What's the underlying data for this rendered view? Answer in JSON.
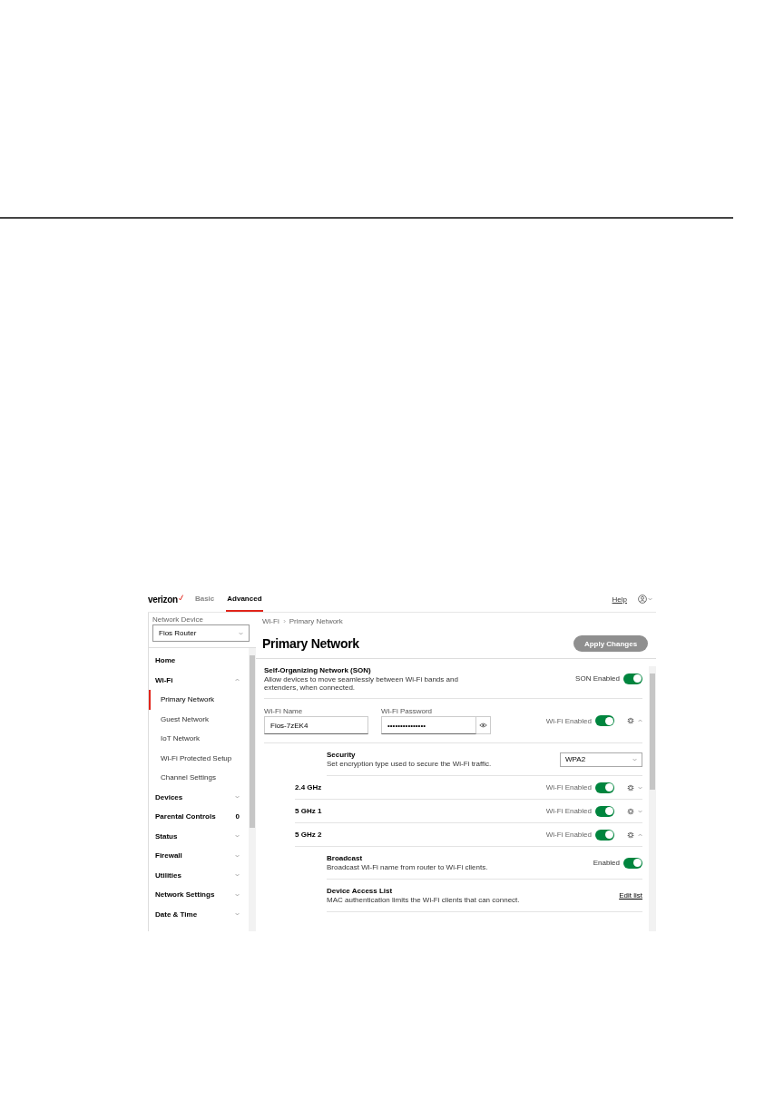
{
  "header": {
    "logo": "verizon",
    "tabs": [
      {
        "label": "Basic",
        "selected": false
      },
      {
        "label": "Advanced",
        "selected": true
      }
    ],
    "help": "Help"
  },
  "sidebar": {
    "device_label": "Network Device",
    "device": "Fios Router",
    "items": [
      {
        "label": "Home",
        "kind": "link"
      },
      {
        "label": "Wi-Fi",
        "kind": "menu",
        "expanded": true,
        "children": [
          {
            "label": "Primary Network",
            "selected": true
          },
          {
            "label": "Guest Network",
            "selected": false
          },
          {
            "label": "IoT Network",
            "selected": false
          },
          {
            "label": "Wi-Fi Protected Setup",
            "selected": false
          },
          {
            "label": "Channel Settings",
            "selected": false
          }
        ]
      },
      {
        "label": "Devices",
        "kind": "menu",
        "expanded": false
      },
      {
        "label": "Parental Controls",
        "kind": "count",
        "count": "0"
      },
      {
        "label": "Status",
        "kind": "menu",
        "expanded": false
      },
      {
        "label": "Firewall",
        "kind": "menu",
        "expanded": false
      },
      {
        "label": "Utilities",
        "kind": "menu",
        "expanded": false
      },
      {
        "label": "Network Settings",
        "kind": "menu",
        "expanded": false
      },
      {
        "label": "Date & Time",
        "kind": "menu",
        "expanded": false
      }
    ]
  },
  "main": {
    "breadcrumb": [
      "Wi-Fi",
      "Primary Network"
    ],
    "title": "Primary Network",
    "apply_button": {
      "label": "Apply Changes",
      "disabled": true
    },
    "son": {
      "title": "Self-Organizing Network (SON)",
      "description": "Allow devices to move seamlessly between Wi-Fi bands and extenders, when connected.",
      "toggle_label": "SON Enabled",
      "on": true
    },
    "wifi": {
      "name_label": "Wi-Fi Name",
      "name_value": "Fios-7zEK4",
      "password_label": "Wi-Fi Password",
      "password_value": "•••••••••••••••",
      "toggle_label": "Wi-Fi Enabled",
      "on": true,
      "expanded": true
    },
    "security": {
      "title": "Security",
      "description": "Set encryption type used to secure the Wi-Fi traffic.",
      "value": "WPA2"
    },
    "bands": [
      {
        "name": "2.4 GHz",
        "toggle_label": "Wi-Fi Enabled",
        "on": true,
        "expanded": false
      },
      {
        "name": "5 GHz 1",
        "toggle_label": "Wi-Fi Enabled",
        "on": true,
        "expanded": false
      },
      {
        "name": "5 GHz 2",
        "toggle_label": "Wi-Fi Enabled",
        "on": true,
        "expanded": true
      }
    ],
    "band_settings": [
      {
        "kind": "toggle",
        "title": "Broadcast",
        "description": "Broadcast Wi-Fi name from router to Wi-Fi clients.",
        "toggle_label": "Enabled",
        "on": true
      },
      {
        "kind": "link",
        "title": "Device Access List",
        "description": "MAC authentication limits the Wi-Fi clients that can connect.",
        "link": "Edit list"
      }
    ]
  }
}
